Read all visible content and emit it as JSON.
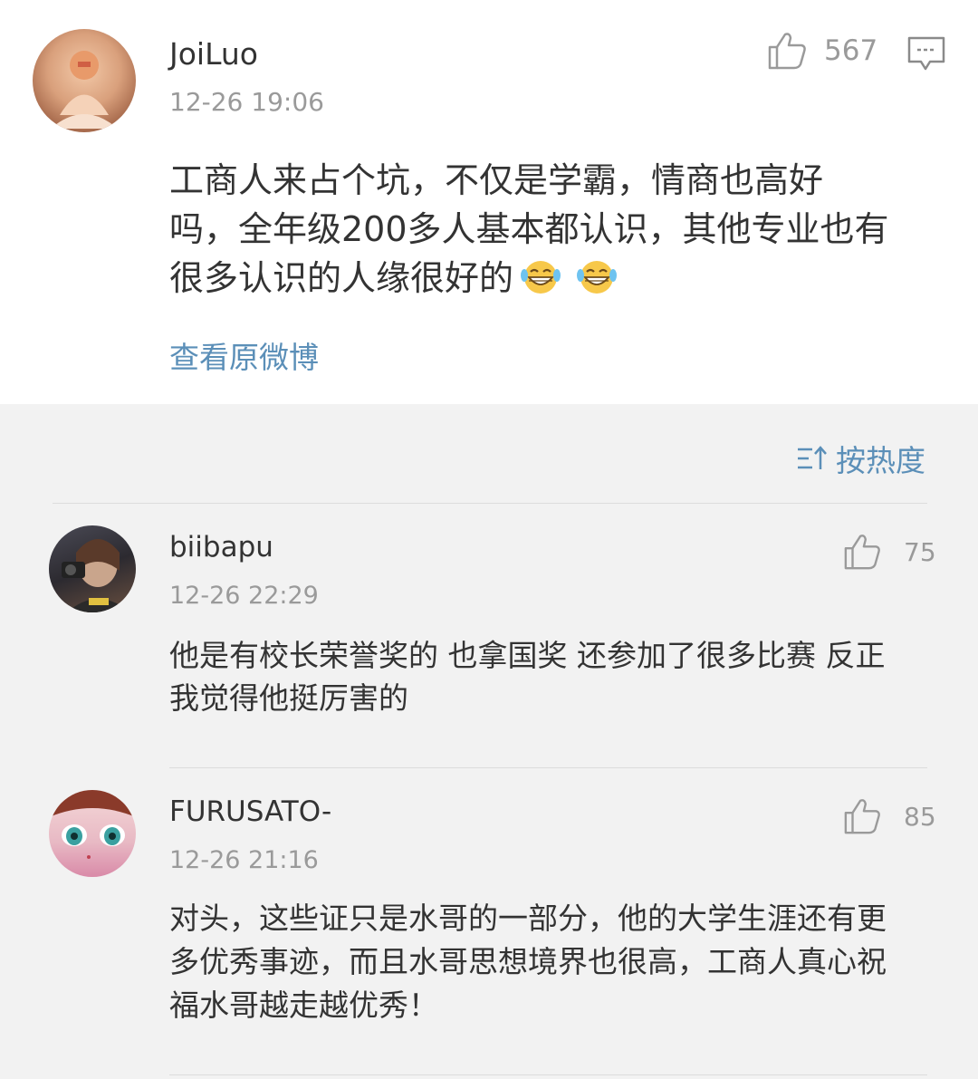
{
  "main_post_comment": {
    "username": "JoiLuo",
    "timestamp": "12-26 19:06",
    "like_count": "567",
    "text_lines": [
      "工商人来占个坑，不仅是学霸，情商也高好",
      "吗，全年级200多人基本都认识，其他专业也有",
      "很多认识的人缘很好的"
    ],
    "emoji": [
      "grin-tears-emoji",
      "grin-tears-emoji"
    ],
    "view_original_label": "查看原微博",
    "icons": {
      "like": "thumbs-up-icon",
      "reply": "comment-bubble-icon"
    }
  },
  "sort": {
    "label": "按热度",
    "icon": "sort-icon"
  },
  "replies": [
    {
      "username": "biibapu",
      "timestamp": "12-26 22:29",
      "like_count": "75",
      "text_lines": [
        "他是有校长荣誉奖的 也拿国奖 还参加了很多比赛 反正",
        "我觉得他挺厉害的"
      ]
    },
    {
      "username": "FURUSATO-",
      "timestamp": "12-26 21:16",
      "like_count": "85",
      "text_lines": [
        "对头，这些证只是水哥的一部分，他的大学生涯还有更",
        "多优秀事迹，而且水哥思想境界也很高，工商人真心祝",
        "福水哥越走越优秀！"
      ]
    }
  ],
  "colors": {
    "link": "#5b8fb8",
    "text": "#333333",
    "secondary_text": "#9a9a9a",
    "background": "#f2f2f2",
    "card": "#ffffff"
  }
}
